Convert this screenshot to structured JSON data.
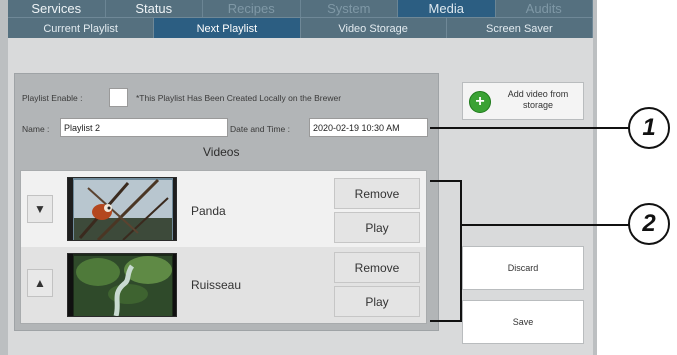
{
  "top_tabs": [
    {
      "label": "Services",
      "state": "normal"
    },
    {
      "label": "Status",
      "state": "normal"
    },
    {
      "label": "Recipes",
      "state": "disabled"
    },
    {
      "label": "System",
      "state": "disabled"
    },
    {
      "label": "Media",
      "state": "active"
    },
    {
      "label": "Audits",
      "state": "disabled"
    }
  ],
  "sub_tabs": [
    {
      "label": "Current Playlist",
      "state": "normal"
    },
    {
      "label": "Next Playlist",
      "state": "active"
    },
    {
      "label": "Video Storage",
      "state": "normal"
    },
    {
      "label": "Screen Saver",
      "state": "normal"
    }
  ],
  "form": {
    "enable_label": "Playlist Enable :",
    "enable_checked": false,
    "note": "*This Playlist Has Been Created Locally on the Brewer",
    "name_label": "Name :",
    "name_value": "Playlist 2",
    "datetime_label": "Date and Time :",
    "datetime_value": "2020-02-19 10:30 AM"
  },
  "videos": {
    "title": "Videos",
    "items": [
      {
        "name": "Panda",
        "arrow": "▼",
        "remove_label": "Remove",
        "play_label": "Play"
      },
      {
        "name": "Ruisseau",
        "arrow": "▲",
        "remove_label": "Remove",
        "play_label": "Play"
      }
    ]
  },
  "side": {
    "add_label": "Add video from storage",
    "discard_label": "Discard",
    "save_label": "Save"
  },
  "callouts": [
    "1",
    "2"
  ],
  "colors": {
    "nav_bg": "#55707f",
    "nav_active": "#2c5e82",
    "panel_bg": "#d9dadb",
    "add_icon": "#3aa234"
  },
  "icons": {
    "add": "plus-circle-icon",
    "move_down": "arrow-down-icon",
    "move_up": "arrow-up-icon"
  }
}
